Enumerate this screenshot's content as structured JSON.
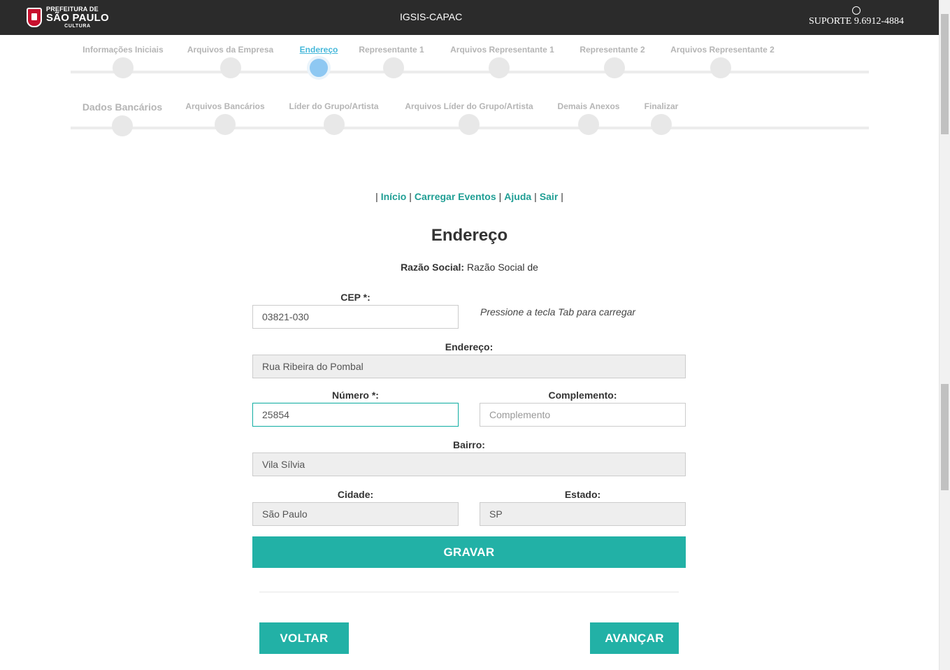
{
  "header": {
    "logo_line1": "PREFEITURA DE",
    "logo_line2": "SÃO PAULO",
    "logo_line3": "CULTURA",
    "app_title": "IGSIS-CAPAC",
    "support": "SUPORTE 9.6912-4884"
  },
  "steps_row1": [
    {
      "label": "Informações Iniciais"
    },
    {
      "label": "Arquivos da Empresa"
    },
    {
      "label": "Endereço",
      "active": true
    },
    {
      "label": "Representante 1"
    },
    {
      "label": "Arquivos Representante 1"
    },
    {
      "label": "Representante 2"
    },
    {
      "label": "Arquivos Representante 2"
    }
  ],
  "steps_row2": [
    {
      "label": "Dados Bancários"
    },
    {
      "label": "Arquivos Bancários"
    },
    {
      "label": "Líder do Grupo/Artista"
    },
    {
      "label": "Arquivos Líder do Grupo/Artista"
    },
    {
      "label": "Demais Anexos"
    },
    {
      "label": "Finalizar"
    }
  ],
  "nav": {
    "inicio": "Início",
    "carregar": "Carregar Eventos",
    "ajuda": "Ajuda",
    "sair": "Sair"
  },
  "page_title": "Endereço",
  "razao": {
    "label": "Razão Social:",
    "value": "Razão Social de"
  },
  "form": {
    "cep_label": "CEP *:",
    "cep_value": "03821-030",
    "cep_hint": "Pressione a tecla Tab para carregar",
    "endereco_label": "Endereço:",
    "endereco_value": "Rua Ribeira do Pombal",
    "numero_label": "Número *:",
    "numero_value": "25854",
    "complemento_label": "Complemento:",
    "complemento_placeholder": "Complemento",
    "bairro_label": "Bairro:",
    "bairro_value": "Vila Sílvia",
    "cidade_label": "Cidade:",
    "cidade_value": "São Paulo",
    "estado_label": "Estado:",
    "estado_value": "SP",
    "gravar": "GRAVAR"
  },
  "footer_buttons": {
    "voltar": "VOLTAR",
    "avancar": "AVANÇAR"
  },
  "colors": {
    "accent": "#22b1a6",
    "link": "#1f9e94",
    "active_step": "#46b8da",
    "header_bg": "#2b2b2b"
  }
}
